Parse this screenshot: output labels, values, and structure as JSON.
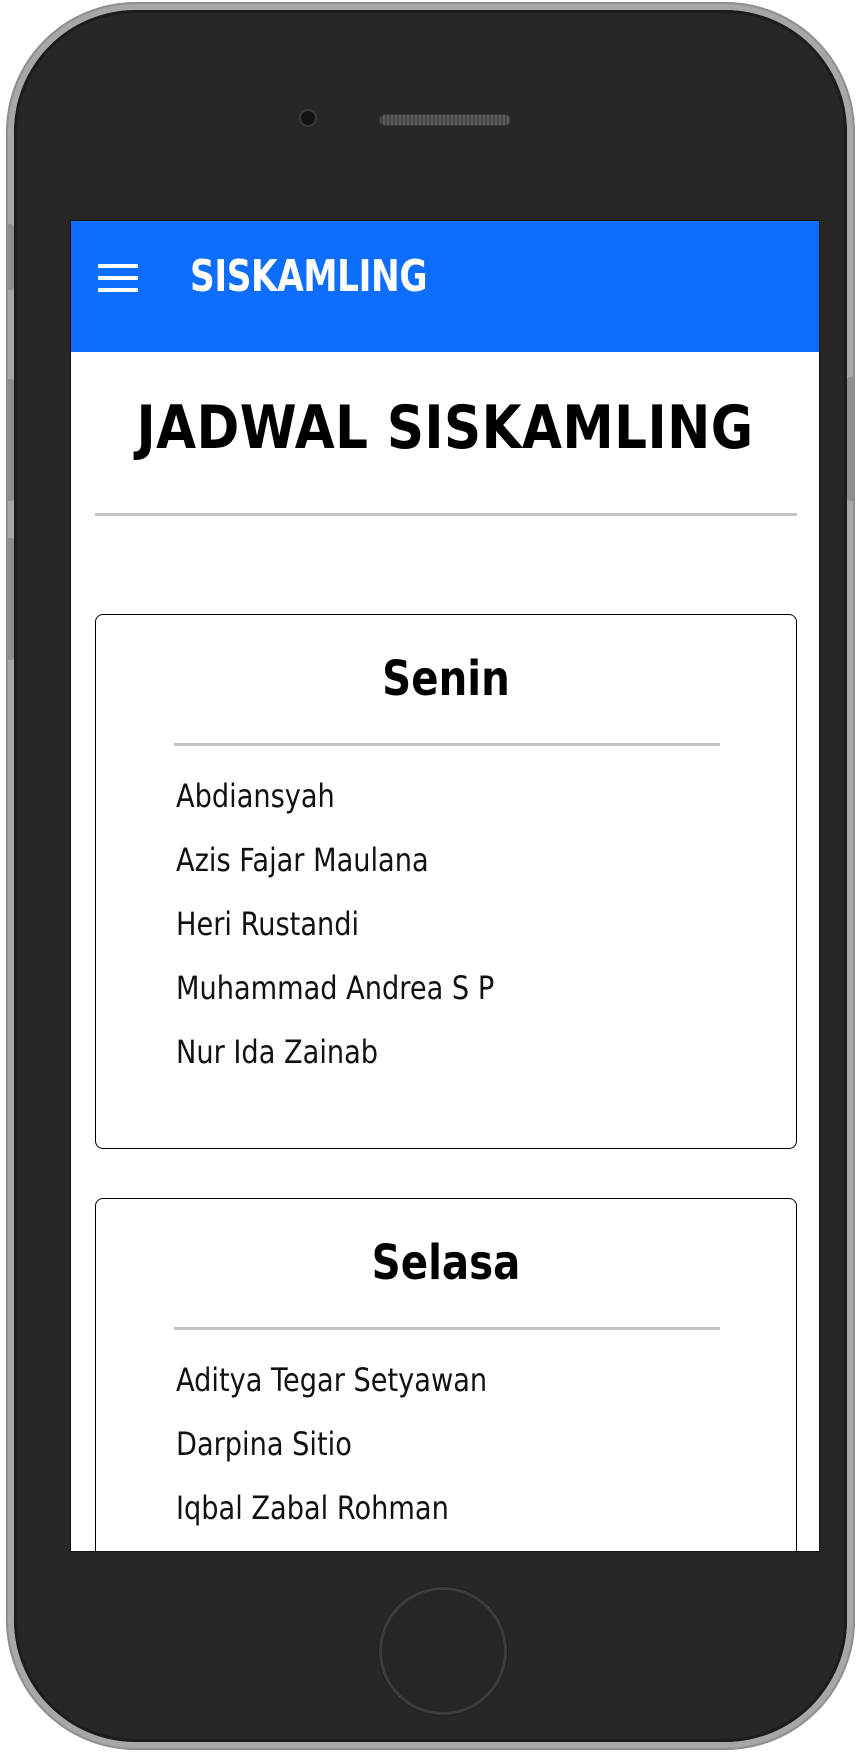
{
  "app_bar": {
    "title": "SISKAMLING"
  },
  "page": {
    "heading": "JADWAL SISKAMLING"
  },
  "schedule": [
    {
      "day": "Senin",
      "names": [
        "Abdiansyah",
        "Azis Fajar Maulana",
        "Heri Rustandi",
        "Muhammad Andrea S P",
        "Nur Ida Zainab"
      ]
    },
    {
      "day": "Selasa",
      "names": [
        "Aditya Tegar Setyawan",
        "Darpina Sitio",
        "Iqbal Zabal Rohman"
      ]
    }
  ],
  "colors": {
    "app_bar": "#0d6efd",
    "divider": "#c4c4c4",
    "phone_frame": "#272727"
  },
  "icons": {
    "menu": "hamburger-menu-icon"
  }
}
